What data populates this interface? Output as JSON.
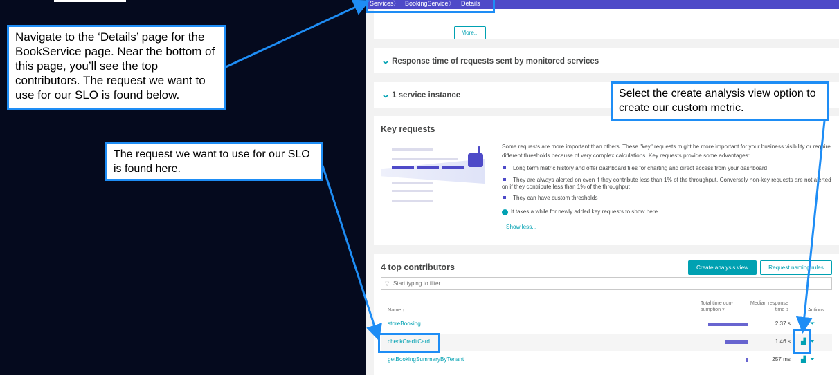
{
  "breadcrumb": [
    "Services",
    "BookingService",
    "Details"
  ],
  "callouts": {
    "navigate": "Navigate to the ‘Details’ page for the BookService page. Near the bottom of this page, you’ll see the top contributors. The request we want to use for our SLO is found below.",
    "request": "The request we want to use for our SLO is found here.",
    "analysis": "Select the create analysis view option to create our custom metric."
  },
  "more_label": "More...",
  "sections": {
    "response_time": "Response time of requests sent by monitored services",
    "service_instance": "1 service instance"
  },
  "key_requests": {
    "title": "Key requests",
    "intro": "Some requests are more important than others. These \"key\" requests might be more important for your business visibility or require different thresholds because of very complex calculations. Key requests provide some advantages:",
    "bullets": [
      "Long term metric history and offer dashboard tiles for charting and direct access from your dashboard",
      "They are always alerted on even if they contribute less than 1% of the throughput. Conversely non-key requests are not alerted on if they contribute less than 1% of the throughput",
      "They can have custom thresholds"
    ],
    "info": "It takes a while for newly added key requests to show here",
    "show_less": "Show less..."
  },
  "top_contributors": {
    "title": "4 top contributors",
    "create_analysis_view": "Create analysis view",
    "request_naming_rules": "Request naming rules",
    "filter_placeholder": "Start typing to filter",
    "headers": {
      "name": "Name ↕",
      "total_time_1": "Total time con-",
      "total_time_2": "sumption ▾",
      "median_1": "Median response",
      "median_2": "time ↕",
      "actions": "Actions"
    },
    "rows": [
      {
        "name": "storeBooking",
        "share": 0.95,
        "median": "2.37 s"
      },
      {
        "name": "checkCreditCard",
        "share": 0.55,
        "median": "1.46 s"
      },
      {
        "name": "getBookingSummaryByTenant",
        "share": 0.05,
        "median": "257 ms"
      }
    ]
  },
  "colors": {
    "accent": "#00a1b2",
    "brand": "#4e4ac8",
    "callout_border": "#1e8df5"
  },
  "icons": [
    "filter-icon",
    "chart-icon",
    "funnel-icon",
    "more-icon",
    "chevron-down-icon",
    "info-icon",
    "thumb-pointer-icon"
  ]
}
